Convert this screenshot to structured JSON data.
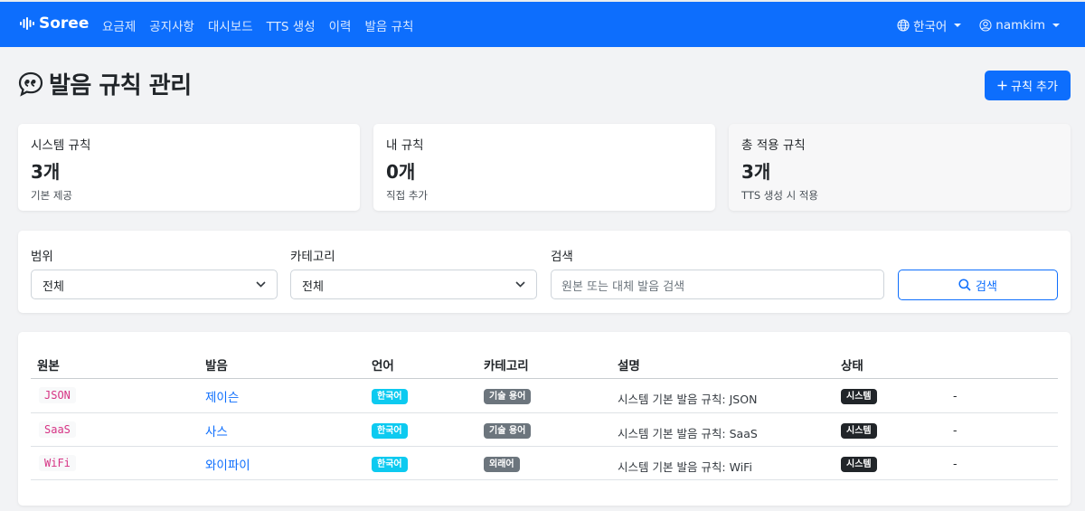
{
  "brand": {
    "name": "Soree"
  },
  "nav": {
    "links": [
      "요금제",
      "공지사항",
      "대시보드",
      "TTS 생성",
      "이력",
      "발음 규칙"
    ],
    "language": "한국어",
    "user": "namkim"
  },
  "page": {
    "title": "발음 규칙 관리",
    "add_button": "규칙 추가"
  },
  "stats": [
    {
      "label": "시스템 규칙",
      "value": "3개",
      "sub": "기본 제공"
    },
    {
      "label": "내 규칙",
      "value": "0개",
      "sub": "직접 추가"
    },
    {
      "label": "총 적용 규칙",
      "value": "3개",
      "sub": "TTS 생성 시 적용"
    }
  ],
  "filters": {
    "scope_label": "범위",
    "scope_value": "전체",
    "category_label": "카테고리",
    "category_value": "전체",
    "search_label": "검색",
    "search_placeholder": "원본 또는 대체 발음 검색",
    "search_button": "검색"
  },
  "table": {
    "headers": [
      "원본",
      "발음",
      "언어",
      "카테고리",
      "설명",
      "상태"
    ],
    "rows": [
      {
        "original": "JSON",
        "pronunciation": "제이슨",
        "language": "한국어",
        "category": "기술 용어",
        "description": "시스템 기본 발음 규칙: JSON",
        "status": "시스템",
        "extra": "-"
      },
      {
        "original": "SaaS",
        "pronunciation": "사스",
        "language": "한국어",
        "category": "기술 용어",
        "description": "시스템 기본 발음 규칙: SaaS",
        "status": "시스템",
        "extra": "-"
      },
      {
        "original": "WiFi",
        "pronunciation": "와이파이",
        "language": "한국어",
        "category": "외래어",
        "description": "시스템 기본 발음 규칙: WiFi",
        "status": "시스템",
        "extra": "-"
      }
    ]
  },
  "colors": {
    "primary": "#0d6efd",
    "info": "#0dcaf0",
    "secondary": "#6c757d",
    "dark": "#212529",
    "code": "#d63384"
  }
}
